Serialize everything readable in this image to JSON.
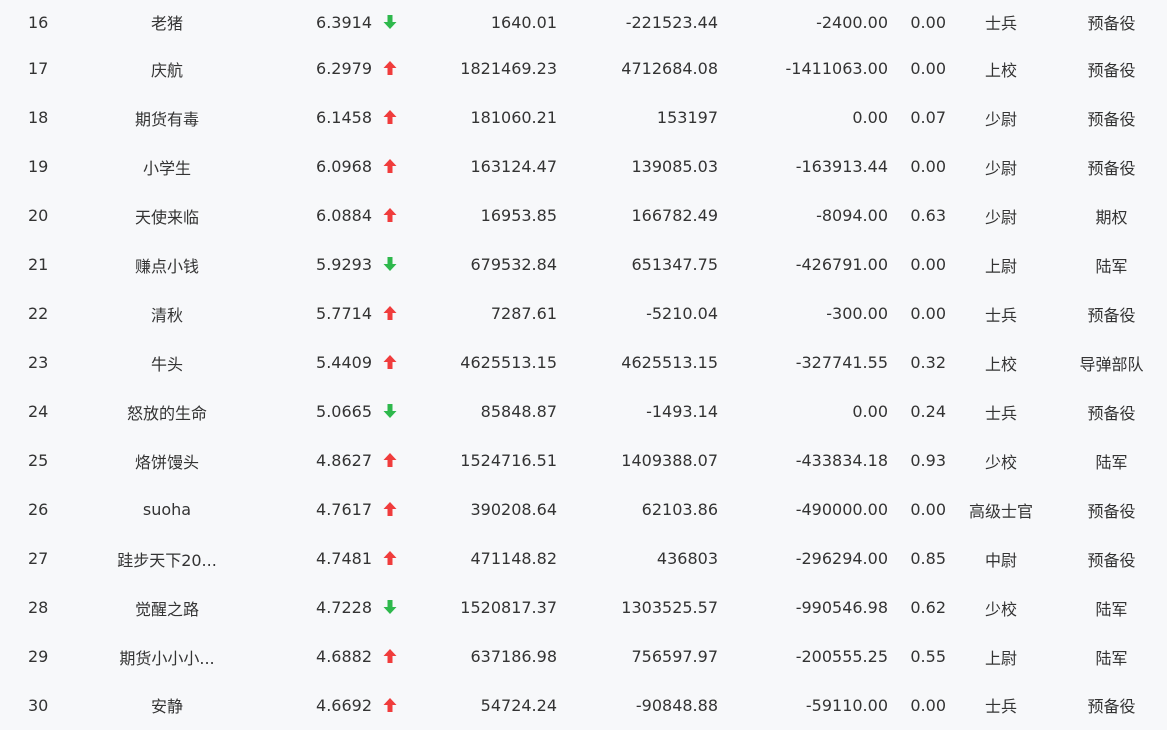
{
  "colors": {
    "up": "#f03c3c",
    "down": "#2eb84c",
    "background": "#f7f8fa",
    "text": "#333333"
  },
  "rows": [
    {
      "rank": "16",
      "name": "老猪",
      "score": "6.3914",
      "trend": "down",
      "v1": "1640.01",
      "v2": "-221523.44",
      "v3": "-2400.00",
      "ratio": "0.00",
      "title": "士兵",
      "group": "预备役"
    },
    {
      "rank": "17",
      "name": "庆航",
      "score": "6.2979",
      "trend": "up",
      "v1": "1821469.23",
      "v2": "4712684.08",
      "v3": "-1411063.00",
      "ratio": "0.00",
      "title": "上校",
      "group": "预备役"
    },
    {
      "rank": "18",
      "name": "期货有毒",
      "score": "6.1458",
      "trend": "up",
      "v1": "181060.21",
      "v2": "153197",
      "v3": "0.00",
      "ratio": "0.07",
      "title": "少尉",
      "group": "预备役"
    },
    {
      "rank": "19",
      "name": "小学生",
      "score": "6.0968",
      "trend": "up",
      "v1": "163124.47",
      "v2": "139085.03",
      "v3": "-163913.44",
      "ratio": "0.00",
      "title": "少尉",
      "group": "预备役"
    },
    {
      "rank": "20",
      "name": "天使来临",
      "score": "6.0884",
      "trend": "up",
      "v1": "16953.85",
      "v2": "166782.49",
      "v3": "-8094.00",
      "ratio": "0.63",
      "title": "少尉",
      "group": "期权"
    },
    {
      "rank": "21",
      "name": "赚点小钱",
      "score": "5.9293",
      "trend": "down",
      "v1": "679532.84",
      "v2": "651347.75",
      "v3": "-426791.00",
      "ratio": "0.00",
      "title": "上尉",
      "group": "陆军"
    },
    {
      "rank": "22",
      "name": "清秋",
      "score": "5.7714",
      "trend": "up",
      "v1": "7287.61",
      "v2": "-5210.04",
      "v3": "-300.00",
      "ratio": "0.00",
      "title": "士兵",
      "group": "预备役"
    },
    {
      "rank": "23",
      "name": "牛头",
      "score": "5.4409",
      "trend": "up",
      "v1": "4625513.15",
      "v2": "4625513.15",
      "v3": "-327741.55",
      "ratio": "0.32",
      "title": "上校",
      "group": "导弹部队"
    },
    {
      "rank": "24",
      "name": "怒放的生命",
      "score": "5.0665",
      "trend": "down",
      "v1": "85848.87",
      "v2": "-1493.14",
      "v3": "0.00",
      "ratio": "0.24",
      "title": "士兵",
      "group": "预备役"
    },
    {
      "rank": "25",
      "name": "烙饼馒头",
      "score": "4.8627",
      "trend": "up",
      "v1": "1524716.51",
      "v2": "1409388.07",
      "v3": "-433834.18",
      "ratio": "0.93",
      "title": "少校",
      "group": "陆军"
    },
    {
      "rank": "26",
      "name": "suoha",
      "score": "4.7617",
      "trend": "up",
      "v1": "390208.64",
      "v2": "62103.86",
      "v3": "-490000.00",
      "ratio": "0.00",
      "title": "高级士官",
      "group": "预备役"
    },
    {
      "rank": "27",
      "name": "跬步天下20...",
      "score": "4.7481",
      "trend": "up",
      "v1": "471148.82",
      "v2": "436803",
      "v3": "-296294.00",
      "ratio": "0.85",
      "title": "中尉",
      "group": "预备役"
    },
    {
      "rank": "28",
      "name": "觉醒之路",
      "score": "4.7228",
      "trend": "down",
      "v1": "1520817.37",
      "v2": "1303525.57",
      "v3": "-990546.98",
      "ratio": "0.62",
      "title": "少校",
      "group": "陆军"
    },
    {
      "rank": "29",
      "name": "期货小小小...",
      "score": "4.6882",
      "trend": "up",
      "v1": "637186.98",
      "v2": "756597.97",
      "v3": "-200555.25",
      "ratio": "0.55",
      "title": "上尉",
      "group": "陆军"
    },
    {
      "rank": "30",
      "name": "安静",
      "score": "4.6692",
      "trend": "up",
      "v1": "54724.24",
      "v2": "-90848.88",
      "v3": "-59110.00",
      "ratio": "0.00",
      "title": "士兵",
      "group": "预备役"
    }
  ]
}
